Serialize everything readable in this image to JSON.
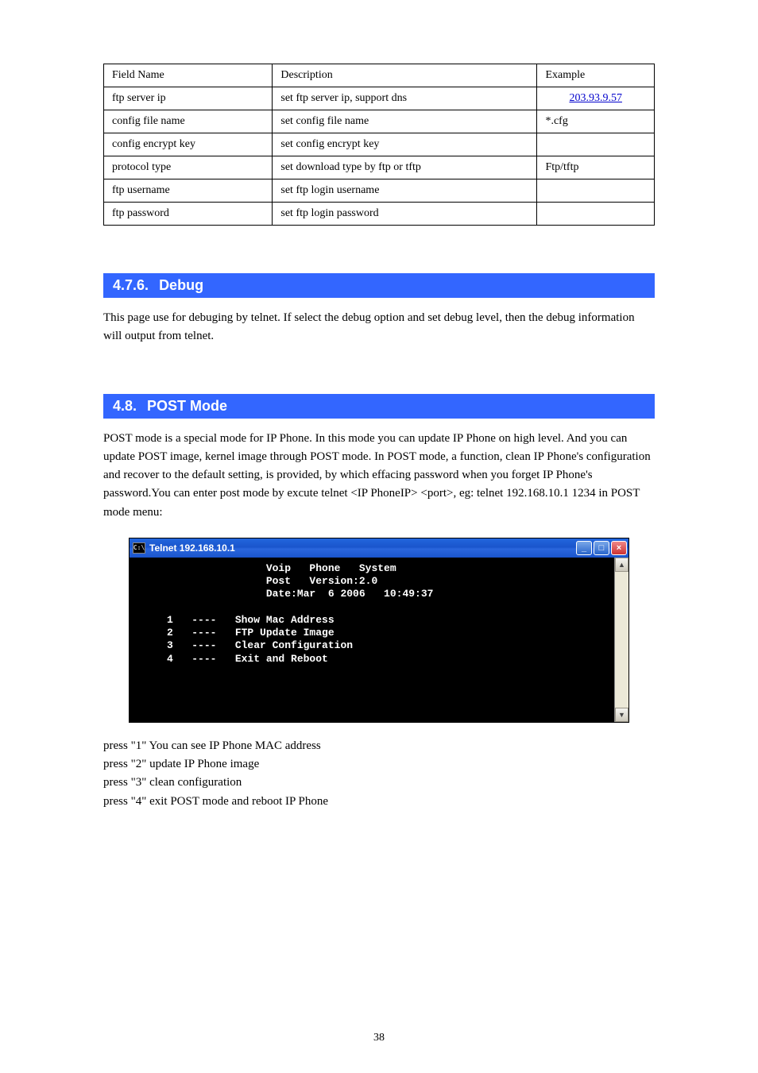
{
  "table": {
    "headers": [
      "Field Name",
      "Description",
      "Example"
    ],
    "rows": [
      [
        "ftp server ip",
        "set ftp server ip, support dns",
        {
          "text": "203.93.9.57",
          "link": true
        }
      ],
      [
        "config file name",
        "set config file name",
        "*.cfg"
      ],
      [
        "config encrypt key",
        "set config encrypt key",
        ""
      ],
      [
        "protocol type",
        "set download type by ftp or tftp",
        "Ftp/tftp"
      ],
      [
        "ftp username",
        "set ftp login username",
        ""
      ],
      [
        "ftp password",
        "set ftp login password",
        ""
      ]
    ]
  },
  "sections": {
    "debug": {
      "num": "4.7.6.",
      "title": "Debug",
      "text": "This page use for debuging by telnet. If select the debug option and set debug level, then the debug information will output from telnet."
    },
    "post": {
      "num": "4.8.",
      "title": "POST Mode",
      "text_before": "POST mode is a special mode for IP Phone. In this mode you can update IP Phone on high level. And you can update POST image, kernel image through POST mode. In POST mode, a function, clean IP Phone's configuration and recover to the default setting, is provided, by which effacing password when you forget IP Phone's password.You can enter post mode by excute telnet <IP PhoneIP> <port>, eg: telnet 192.168.10.1 1234 in POST mode menu: ",
      "text_after": "press \"1\" You can see IP Phone MAC address\npress \"2\" update IP Phone image\npress \"3\" clean configuration\npress \"4\" exit POST mode and reboot IP Phone"
    }
  },
  "terminal": {
    "title": "Telnet 192.168.10.1",
    "icon_label": "C:\\",
    "content": "                     Voip   Phone   System\n                     Post   Version:2.0\n                     Date:Mar  6 2006   10:49:37\n\n     1   ----   Show Mac Address\n     2   ----   FTP Update Image\n     3   ----   Clear Configuration\n     4   ----   Exit and Reboot\n\n\n\n\n"
  },
  "page_number": "38"
}
